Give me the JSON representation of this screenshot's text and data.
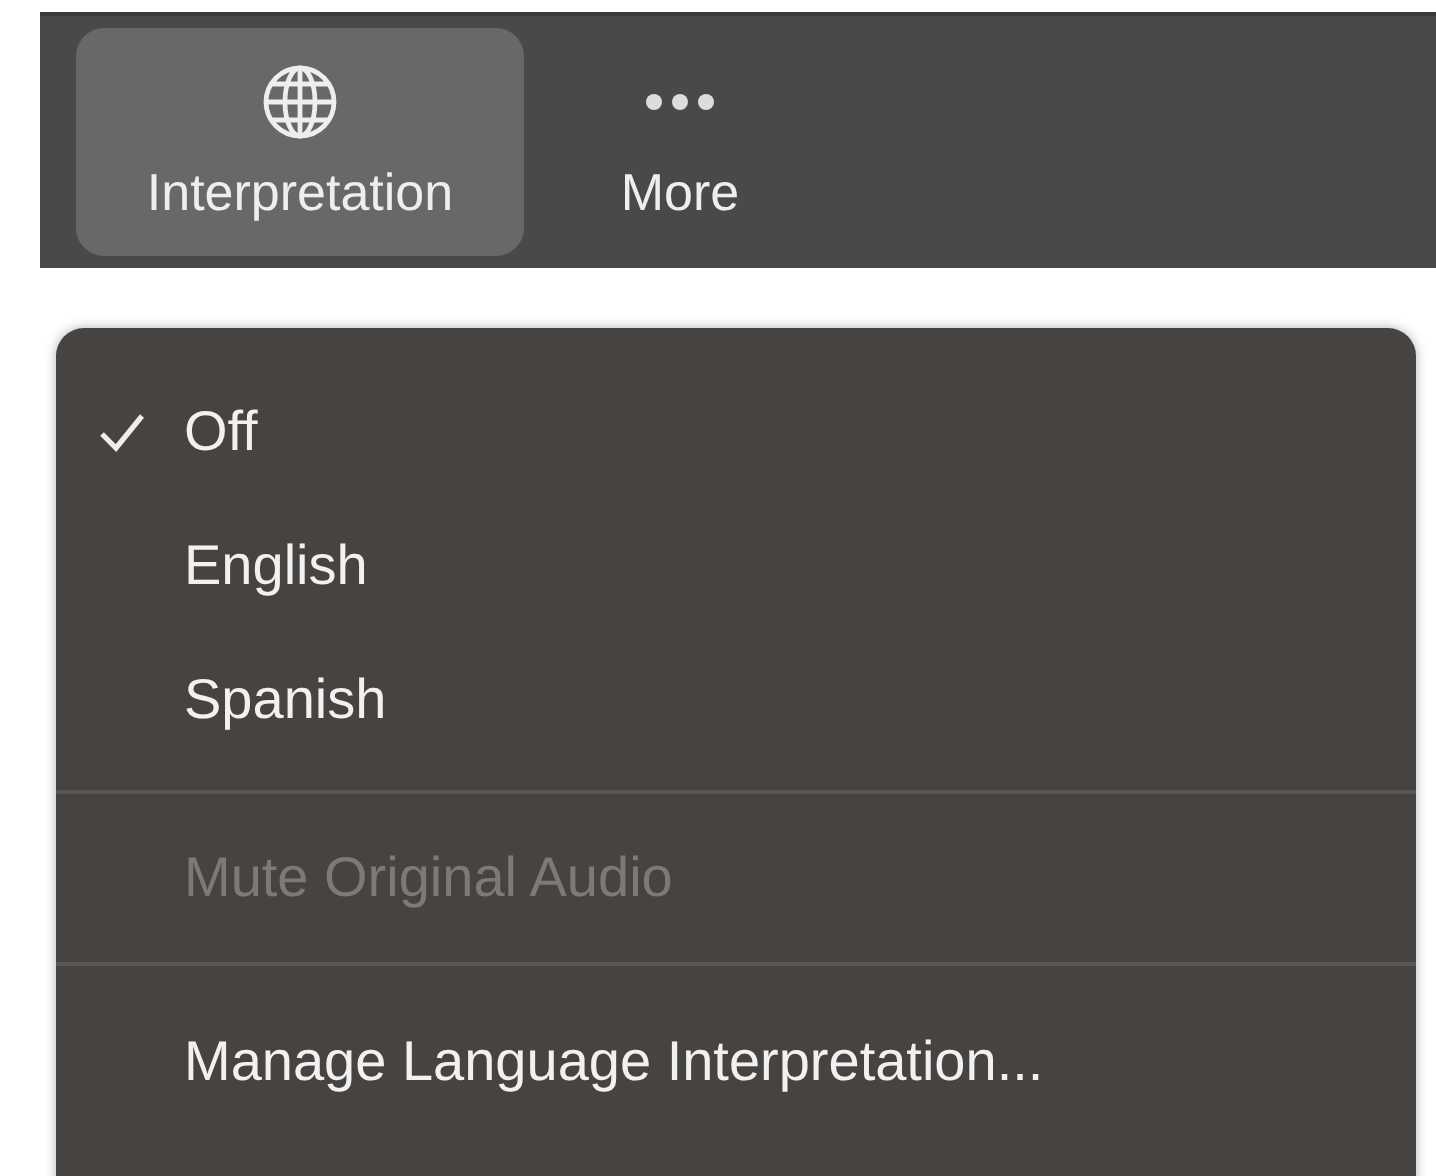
{
  "toolbar": {
    "buttons": [
      {
        "label": "Interpretation",
        "kind": "globe",
        "selected": true
      },
      {
        "label": "More",
        "kind": "dots",
        "selected": false
      }
    ]
  },
  "menu": {
    "items": [
      {
        "kind": "option",
        "label": "Off",
        "checked": true
      },
      {
        "kind": "option",
        "label": "English",
        "checked": false
      },
      {
        "kind": "option",
        "label": "Spanish",
        "checked": false
      },
      {
        "kind": "separator"
      },
      {
        "kind": "action",
        "label": "Mute Original Audio",
        "disabled": true
      },
      {
        "kind": "separator"
      },
      {
        "kind": "action",
        "label": "Manage Language Interpretation...",
        "disabled": false
      }
    ]
  }
}
